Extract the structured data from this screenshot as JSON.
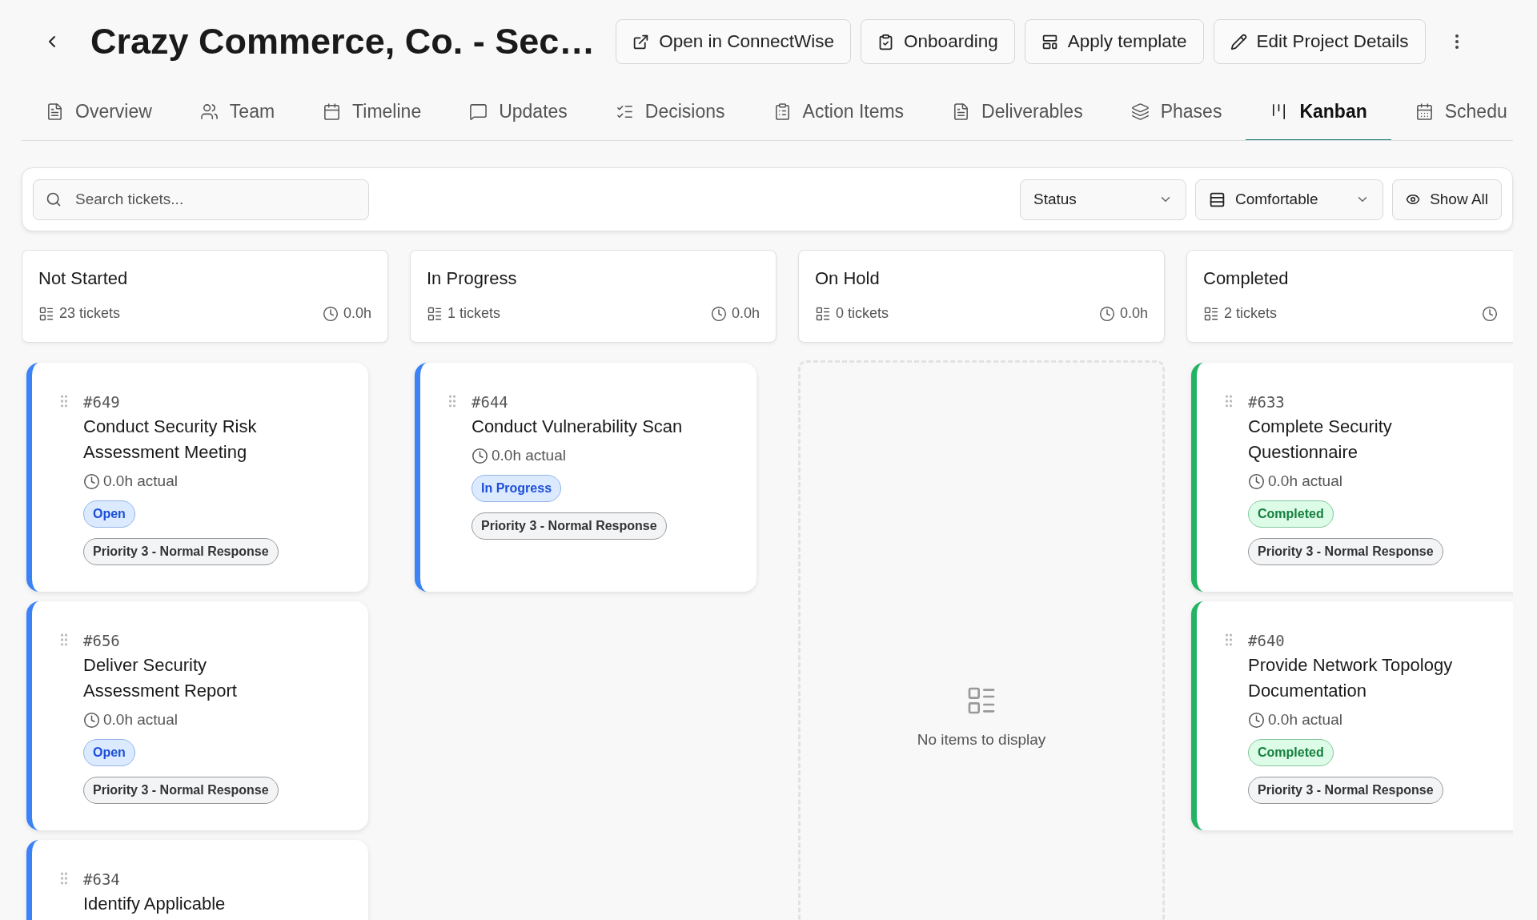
{
  "header": {
    "title": "Crazy Commerce, Co. - Sec…",
    "actions": [
      {
        "kind": "external",
        "label": "Open in ConnectWise"
      },
      {
        "kind": "clipboard",
        "label": "Onboarding"
      },
      {
        "kind": "template",
        "label": "Apply template"
      },
      {
        "kind": "edit",
        "label": "Edit Project Details"
      }
    ]
  },
  "tabs": [
    {
      "kind": "file",
      "label": "Overview",
      "selected": false
    },
    {
      "kind": "users",
      "label": "Team",
      "selected": false
    },
    {
      "kind": "calendar",
      "label": "Timeline",
      "selected": false
    },
    {
      "kind": "message",
      "label": "Updates",
      "selected": false
    },
    {
      "kind": "checklist",
      "label": "Decisions",
      "selected": false
    },
    {
      "kind": "clipboard",
      "label": "Action Items",
      "selected": false
    },
    {
      "kind": "file",
      "label": "Deliverables",
      "selected": false
    },
    {
      "kind": "layers",
      "label": "Phases",
      "selected": false
    },
    {
      "kind": "kanban",
      "label": "Kanban",
      "selected": true
    },
    {
      "kind": "calendar-days",
      "label": "Schedu",
      "selected": false
    }
  ],
  "toolbar": {
    "search": {
      "placeholder": "Search tickets..."
    },
    "status_filter": "Status",
    "density": "Comfortable",
    "show_all": "Show All"
  },
  "columns": [
    {
      "title": "Not Started",
      "count": "23 tickets",
      "hours": "0.0h",
      "cards": [
        {
          "id": "#649",
          "title": "Conduct Security Risk Assessment Meeting",
          "hours": "0.0h actual",
          "status": {
            "kind": "open",
            "label": "Open"
          },
          "priority": "Priority 3 - Normal Response"
        },
        {
          "id": "#656",
          "title": "Deliver Security Assessment Report",
          "hours": "0.0h actual",
          "status": {
            "kind": "open",
            "label": "Open"
          },
          "priority": "Priority 3 - Normal Response"
        },
        {
          "id": "#634",
          "title": "Identify Applicable"
        }
      ]
    },
    {
      "title": "In Progress",
      "count": "1 tickets",
      "hours": "0.0h",
      "cards": [
        {
          "id": "#644",
          "title": "Conduct Vulnerability Scan",
          "hours": "0.0h actual",
          "status": {
            "kind": "progress",
            "label": "In Progress"
          },
          "priority": "Priority 3 - Normal Response"
        }
      ]
    },
    {
      "title": "On Hold",
      "count": "0 tickets",
      "hours": "0.0h",
      "empty_text": "No items to display"
    },
    {
      "title": "Completed",
      "count": "2 tickets",
      "cards": [
        {
          "id": "#633",
          "title": "Complete Security Questionnaire",
          "hours": "0.0h actual",
          "status": {
            "kind": "completed",
            "label": "Completed"
          },
          "priority": "Priority 3 - Normal Response"
        },
        {
          "id": "#640",
          "title": "Provide Network Topology Documentation",
          "hours": "0.0h actual",
          "status": {
            "kind": "completed",
            "label": "Completed"
          },
          "priority": "Priority 3 - Normal Response"
        }
      ]
    }
  ]
}
